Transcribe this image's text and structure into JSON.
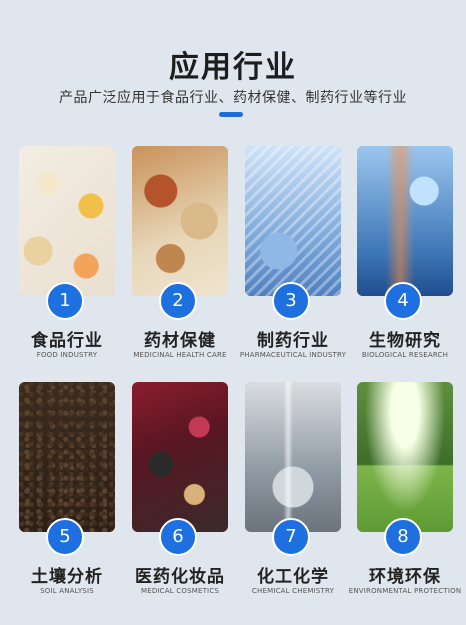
{
  "header": {
    "title": "应用行业",
    "subtitle": "产品广泛应用于食品行业、药材保健、制药行业等行业"
  },
  "industries": [
    {
      "num": "1",
      "cn": "食品行业",
      "en": "FOOD INDUSTRY"
    },
    {
      "num": "2",
      "cn": "药材保健",
      "en": "MEDICINAL HEALTH CARE"
    },
    {
      "num": "3",
      "cn": "制药行业",
      "en": "PHARMACEUTICAL INDUSTRY"
    },
    {
      "num": "4",
      "cn": "生物研究",
      "en": "BIOLOGICAL RESEARCH"
    },
    {
      "num": "5",
      "cn": "土壤分析",
      "en": "SOIL ANALYSIS"
    },
    {
      "num": "6",
      "cn": "医药化妆品",
      "en": "MEDICAL COSMETICS"
    },
    {
      "num": "7",
      "cn": "化工化学",
      "en": "CHEMICAL CHEMISTRY"
    },
    {
      "num": "8",
      "cn": "环境环保",
      "en": "ENVIRONMENTAL PROTECTION"
    }
  ],
  "colors": {
    "background": "#dfe6ee",
    "accent": "#1e6fe0"
  }
}
